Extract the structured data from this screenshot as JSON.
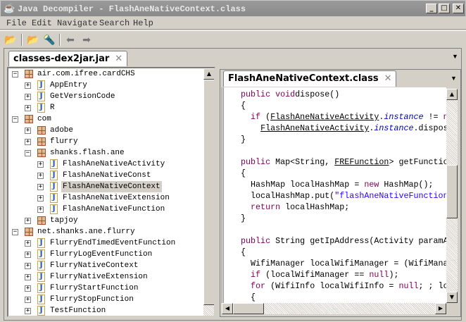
{
  "window": {
    "title": "Java Decompiler - FlashAneNativeContext.class",
    "minimize": "_",
    "maximize": "□",
    "close": "✕"
  },
  "menu": [
    "File",
    "Edit",
    "Navigate",
    "Search",
    "Help"
  ],
  "toolbar": {
    "open": "📂",
    "open_type": "📂",
    "search": "🔦",
    "back": "⬅",
    "forward": "➡"
  },
  "outer_tab": {
    "label": "classes-dex2jar.jar",
    "close": "✕"
  },
  "inner_tab": {
    "label": "FlashAneNativeContext.class",
    "close": "✕"
  },
  "tree": [
    {
      "label": "air.com.ifree.cardCHS",
      "level": 0,
      "type": "pkg",
      "exp": "−"
    },
    {
      "label": "AppEntry",
      "level": 1,
      "type": "cls",
      "exp": "+"
    },
    {
      "label": "GetVersionCode",
      "level": 1,
      "type": "cls",
      "exp": "+"
    },
    {
      "label": "R",
      "level": 1,
      "type": "cls",
      "exp": "+"
    },
    {
      "label": "com",
      "level": 0,
      "type": "pkg",
      "exp": "−"
    },
    {
      "label": "adobe",
      "level": 1,
      "type": "pkg",
      "exp": "+"
    },
    {
      "label": "flurry",
      "level": 1,
      "type": "pkg",
      "exp": "+"
    },
    {
      "label": "shanks.flash.ane",
      "level": 1,
      "type": "pkg",
      "exp": "−"
    },
    {
      "label": "FlashAneNativeActivity",
      "level": 2,
      "type": "cls",
      "exp": "+"
    },
    {
      "label": "FlashAneNativeConst",
      "level": 2,
      "type": "cls",
      "exp": "+"
    },
    {
      "label": "FlashAneNativeContext",
      "level": 2,
      "type": "cls",
      "exp": "+",
      "selected": true
    },
    {
      "label": "FlashAneNativeExtension",
      "level": 2,
      "type": "cls",
      "exp": "+"
    },
    {
      "label": "FlashAneNativeFunction",
      "level": 2,
      "type": "cls",
      "exp": "+"
    },
    {
      "label": "tapjoy",
      "level": 1,
      "type": "pkg",
      "exp": "+"
    },
    {
      "label": "net.shanks.ane.flurry",
      "level": 0,
      "type": "pkg",
      "exp": "−"
    },
    {
      "label": "FlurryEndTimedEventFunction",
      "level": 1,
      "type": "cls",
      "exp": "+"
    },
    {
      "label": "FlurryLogEventFunction",
      "level": 1,
      "type": "cls",
      "exp": "+"
    },
    {
      "label": "FlurryNativeContext",
      "level": 1,
      "type": "cls",
      "exp": "+"
    },
    {
      "label": "FlurryNativeExtension",
      "level": 1,
      "type": "cls",
      "exp": "+"
    },
    {
      "label": "FlurryStartFunction",
      "level": 1,
      "type": "cls",
      "exp": "+"
    },
    {
      "label": "FlurryStopFunction",
      "level": 1,
      "type": "cls",
      "exp": "+"
    },
    {
      "label": "TestFunction",
      "level": 1,
      "type": "cls",
      "exp": "+"
    }
  ],
  "code": [
    [
      [
        "kw",
        "public void"
      ],
      [
        "",
        "dispose()"
      ]
    ],
    [
      [
        "",
        "{"
      ]
    ],
    [
      [
        "",
        "  "
      ],
      [
        "kw",
        "if"
      ],
      [
        "",
        " ("
      ],
      [
        "ul",
        "FlashAneNativeActivity"
      ],
      [
        "",
        "."
      ],
      [
        "it",
        "instance"
      ],
      [
        "",
        " != "
      ],
      [
        "kw",
        "null"
      ]
    ],
    [
      [
        "",
        "    "
      ],
      [
        "ul",
        "FlashAneNativeActivity"
      ],
      [
        "",
        "."
      ],
      [
        "it",
        "instance"
      ],
      [
        "",
        ".dispose();"
      ]
    ],
    [
      [
        "",
        "}"
      ]
    ],
    [
      [
        "",
        ""
      ]
    ],
    [
      [
        "kw",
        "public"
      ],
      [
        "",
        " Map<String, "
      ],
      [
        "ul",
        "FREFunction"
      ],
      [
        "",
        "> getFunctions()"
      ]
    ],
    [
      [
        "",
        "{"
      ]
    ],
    [
      [
        "",
        "  HashMap localHashMap = "
      ],
      [
        "kw",
        "new"
      ],
      [
        "",
        " HashMap();"
      ]
    ],
    [
      [
        "",
        "  localHashMap.put("
      ],
      [
        "st",
        "\"flashAneNativeFunction\""
      ]
    ],
    [
      [
        "",
        "  "
      ],
      [
        "kw",
        "return"
      ],
      [
        "",
        " localHashMap;"
      ]
    ],
    [
      [
        "",
        "}"
      ]
    ],
    [
      [
        "",
        ""
      ]
    ],
    [
      [
        "kw",
        "public"
      ],
      [
        "",
        " String getIpAddress(Activity paramActivity)"
      ]
    ],
    [
      [
        "",
        "{"
      ]
    ],
    [
      [
        "",
        "  WifiManager localWifiManager = (WifiManager)"
      ]
    ],
    [
      [
        "",
        "  "
      ],
      [
        "kw",
        "if"
      ],
      [
        "",
        " (localWifiManager == "
      ],
      [
        "kw",
        "null"
      ],
      [
        "",
        ");"
      ]
    ],
    [
      [
        "",
        "  "
      ],
      [
        "kw",
        "for"
      ],
      [
        "",
        " (WifiInfo localWifiInfo = "
      ],
      [
        "kw",
        "null"
      ],
      [
        "",
        "; ; localWifiInfo"
      ]
    ],
    [
      [
        "",
        "  {"
      ]
    ]
  ]
}
